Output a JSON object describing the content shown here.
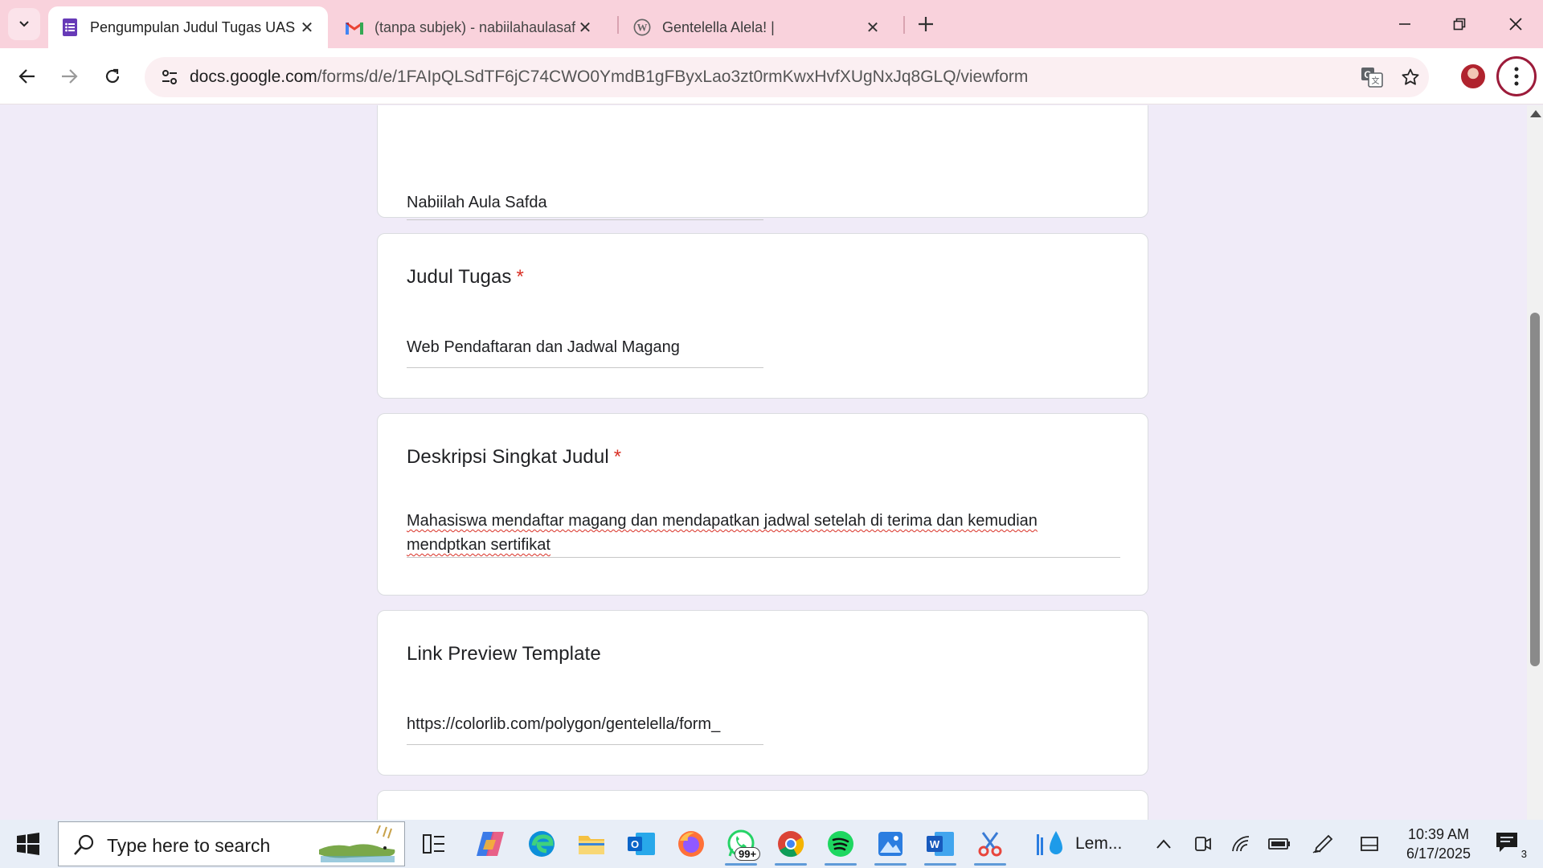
{
  "browser": {
    "tabs": [
      {
        "title": "Pengumpulan Judul Tugas UAS",
        "icon": "google-forms-icon",
        "active": true
      },
      {
        "title": "(tanpa subjek) - nabiilahaulasafi",
        "icon": "gmail-icon",
        "active": false
      },
      {
        "title": "Gentelella Alela! |",
        "icon": "wordpress-icon",
        "active": false
      }
    ],
    "url_host": "docs.google.com",
    "url_path": "/forms/d/e/1FAIpQLSdTF6jC74CWO0YmdB1gFByxLao3zt0rmKwxHvfXUgNxJq8GLQ/viewform"
  },
  "form": {
    "cards": [
      {
        "title": "",
        "required": false,
        "answer": "Nabiilah Aula Safda"
      },
      {
        "title": "Judul Tugas",
        "required": true,
        "answer": "Web Pendaftaran dan Jadwal Magang"
      },
      {
        "title": "Deskripsi Singkat Judul",
        "required": true,
        "answer": "Mahasiswa mendaftar magang dan mendapatkan jadwal setelah di terima dan kemudian mendptkan sertifikat"
      },
      {
        "title": "Link Preview Template",
        "required": false,
        "answer": "https://colorlib.com/polygon/gentelella/form_"
      }
    ],
    "required_mark": "*"
  },
  "taskbar": {
    "search_placeholder": "Type here to search",
    "whatsapp_badge": "99+",
    "lem_label": "Lem...",
    "time": "10:39 AM",
    "date": "6/17/2025",
    "notification_count": "3"
  },
  "colors": {
    "tabstrip": "#f9d2dc",
    "forms_purple": "#673ab7",
    "page_bg": "#f0ebf8",
    "required_red": "#d93025"
  }
}
